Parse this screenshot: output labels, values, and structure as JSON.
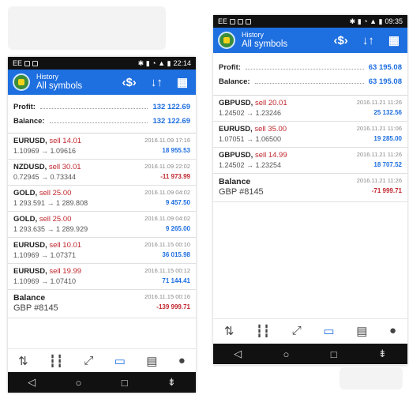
{
  "left": {
    "status": {
      "carrier": "EE",
      "time": "22:14"
    },
    "appbar": {
      "subtitle": "History",
      "title": "All symbols"
    },
    "summary": {
      "profit_label": "Profit:",
      "profit_value": "132 122.69",
      "balance_label": "Balance:",
      "balance_value": "132 122.69"
    },
    "deals": [
      {
        "symbol": "EURUSD,",
        "action": "sell 14.01",
        "prices": "1.10969 → 1.09616",
        "time": "2016.11.09 17:16",
        "pl": "18 955.53",
        "neg": false
      },
      {
        "symbol": "NZDUSD,",
        "action": "sell 30.01",
        "prices": "0.72945 → 0.73344",
        "time": "2016.11.09 22:02",
        "pl": "-11 973.99",
        "neg": true
      },
      {
        "symbol": "GOLD,",
        "action": "sell 25.00",
        "prices": "1 293.591 → 1 289.808",
        "time": "2016.11.09 04:02",
        "pl": "9 457.50",
        "neg": false
      },
      {
        "symbol": "GOLD,",
        "action": "sell 25.00",
        "prices": "1 293.635 → 1 289.929",
        "time": "2016.11.09 04:02",
        "pl": "9 265.00",
        "neg": false
      },
      {
        "symbol": "EURUSD,",
        "action": "sell 10.01",
        "prices": "1.10969 → 1.07371",
        "time": "2016.11.15 00:10",
        "pl": "36 015.98",
        "neg": false
      },
      {
        "symbol": "EURUSD,",
        "action": "sell 19.99",
        "prices": "1.10969 → 1.07410",
        "time": "2016.11.15 00:12",
        "pl": "71 144.41",
        "neg": false
      }
    ],
    "balance_entry": {
      "title": "Balance",
      "detail": "GBP #8145",
      "time": "2016.11.15 00:16",
      "pl": "-139 999.71"
    }
  },
  "right": {
    "status": {
      "carrier": "EE",
      "time": "09:35"
    },
    "appbar": {
      "subtitle": "History",
      "title": "All symbols"
    },
    "summary": {
      "profit_label": "Profit:",
      "profit_value": "63 195.08",
      "balance_label": "Balance:",
      "balance_value": "63 195.08"
    },
    "deals": [
      {
        "symbol": "GBPUSD,",
        "action": "sell 20.01",
        "prices": "1.24502 → 1.23246",
        "time": "2016.11.21 11:26",
        "pl": "25 132.56",
        "neg": false
      },
      {
        "symbol": "EURUSD,",
        "action": "sell 35.00",
        "prices": "1.07051 → 1.06500",
        "time": "2016.11.21 11:06",
        "pl": "19 285.00",
        "neg": false
      },
      {
        "symbol": "GBPUSD,",
        "action": "sell 14.99",
        "prices": "1.24502 → 1.23254",
        "time": "2016.11.21 11:26",
        "pl": "18 707.52",
        "neg": false
      }
    ],
    "balance_entry": {
      "title": "Balance",
      "detail": "GBP #8145",
      "time": "2016.11.21 11:26",
      "pl": "-71 999.71"
    }
  },
  "icons": {
    "appbar": [
      "currency-exchange-icon",
      "sort-icon",
      "calendar-icon"
    ],
    "bottomnav": [
      "quotes-icon",
      "chart-icon",
      "trade-icon",
      "history-icon",
      "news-icon",
      "chat-icon"
    ],
    "sysnav": [
      "back-icon",
      "home-icon",
      "recents-icon",
      "notifications-icon"
    ]
  },
  "colors": {
    "accent": "#1e6fe0",
    "sell": "#c0272d",
    "statusbar": "#111111"
  }
}
